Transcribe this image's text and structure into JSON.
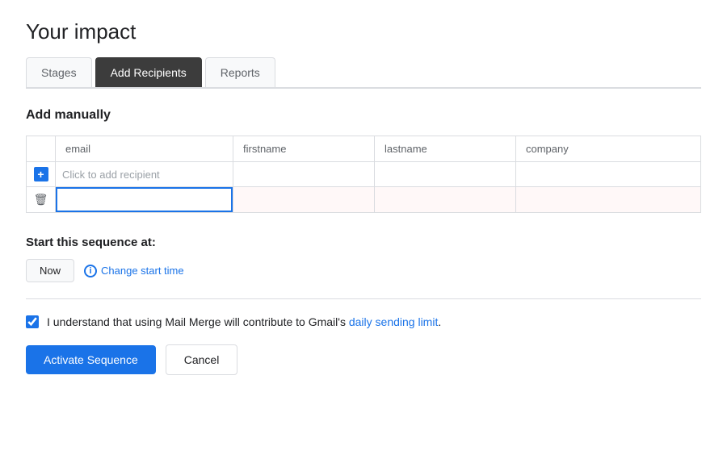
{
  "page": {
    "title": "Your impact"
  },
  "tabs": [
    {
      "id": "stages",
      "label": "Stages",
      "active": false
    },
    {
      "id": "add-recipients",
      "label": "Add Recipients",
      "active": true
    },
    {
      "id": "reports",
      "label": "Reports",
      "active": false
    }
  ],
  "add_manually": {
    "section_title": "Add manually",
    "table": {
      "columns": [
        "",
        "email",
        "firstname",
        "lastname",
        "company"
      ],
      "add_row": {
        "placeholder": "Click to add recipient"
      },
      "editing_row": {
        "email_value": ""
      }
    }
  },
  "sequence": {
    "label": "Start this sequence at:",
    "now_button": "Now",
    "change_time_label": "Change start time"
  },
  "consent": {
    "text_before_link": "I understand that using Mail Merge will contribute to Gmail's ",
    "link_text": "daily sending limit",
    "text_after_link": "."
  },
  "actions": {
    "activate_label": "Activate Sequence",
    "cancel_label": "Cancel"
  }
}
